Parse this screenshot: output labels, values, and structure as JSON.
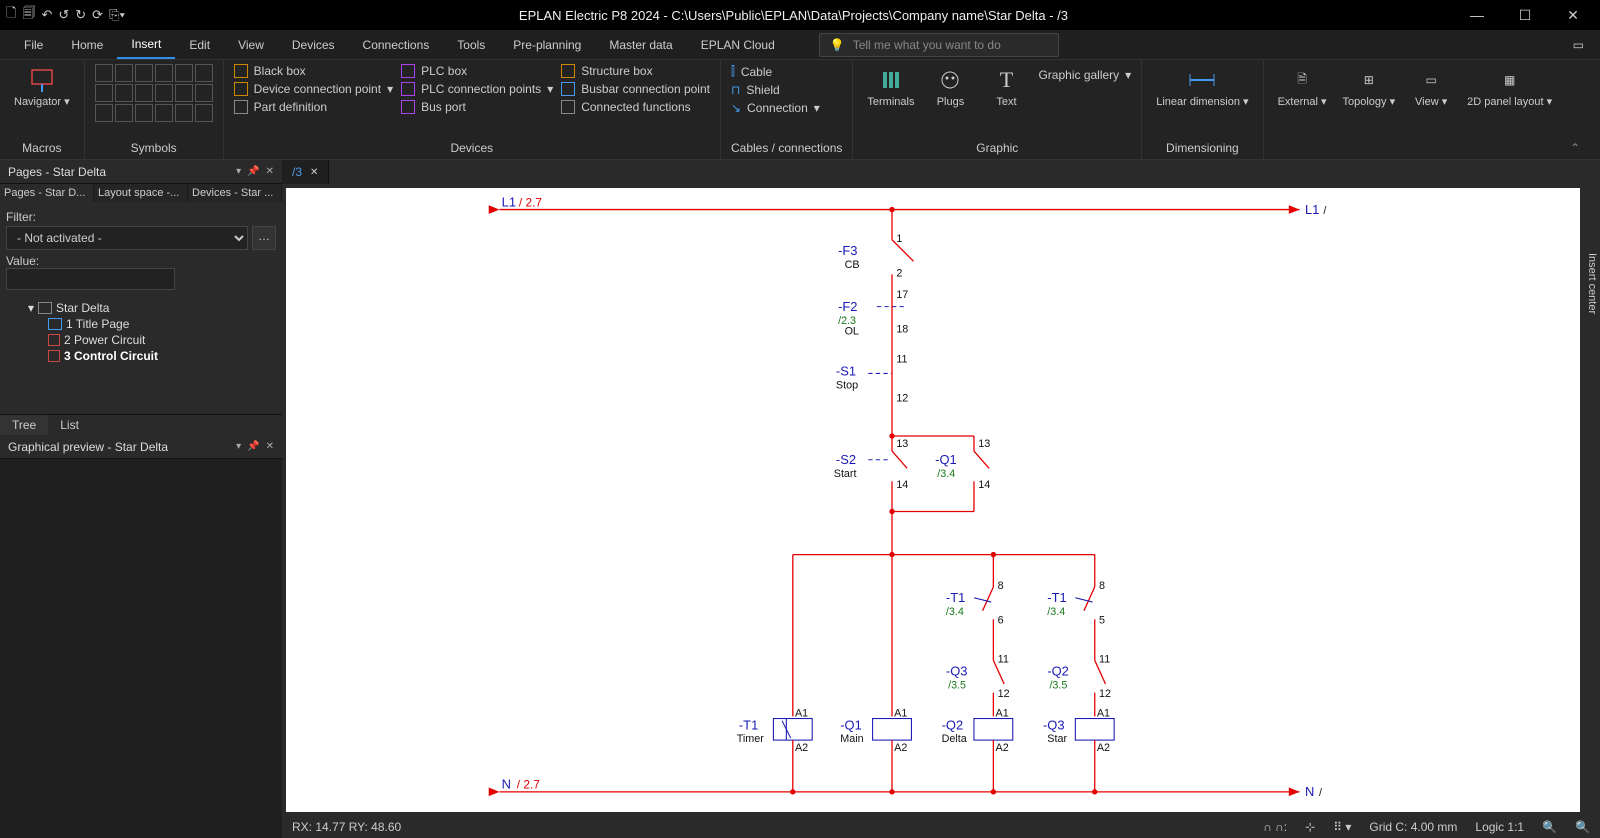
{
  "title": "EPLAN Electric P8 2024 - C:\\Users\\Public\\EPLAN\\Data\\Projects\\Company name\\Star Delta - /3",
  "menu": {
    "tabs": [
      "File",
      "Home",
      "Insert",
      "Edit",
      "View",
      "Devices",
      "Connections",
      "Tools",
      "Pre-planning",
      "Master data",
      "EPLAN Cloud"
    ],
    "active": 2,
    "search_placeholder": "Tell me what you want to do"
  },
  "ribbon": {
    "macros": {
      "navigator": "Navigator",
      "label": "Macros"
    },
    "symbols": {
      "label": "Symbols"
    },
    "devices": {
      "label": "Devices",
      "col1": [
        "Black box",
        "Device connection point",
        "Part definition"
      ],
      "col2": [
        "PLC box",
        "PLC connection points",
        "Bus port"
      ],
      "col3": [
        "Structure box",
        "Busbar connection point",
        "Connected functions"
      ]
    },
    "cables": {
      "label": "Cables / connections",
      "items": [
        "Cable",
        "Shield",
        "Connection"
      ]
    },
    "graphic": {
      "label": "Graphic",
      "terminals": "Terminals",
      "plugs": "Plugs",
      "text": "Text",
      "gallery": "Graphic gallery"
    },
    "dimensioning": {
      "label": "Dimensioning",
      "linear": "Linear dimension"
    },
    "external": "External",
    "topology": "Topology",
    "view": "View",
    "panel": "2D panel layout"
  },
  "pagesPanel": {
    "title": "Pages - Star Delta",
    "subtabs": [
      "Pages - Star D...",
      "Layout space -...",
      "Devices - Star ..."
    ],
    "filter_label": "Filter:",
    "filter_value": "- Not activated -",
    "value_label": "Value:",
    "root": "Star Delta",
    "pages": [
      "1 Title Page",
      "2 Power Circuit",
      "3 Control Circuit"
    ],
    "selected": 2,
    "view_tabs": [
      "Tree",
      "List"
    ]
  },
  "previewPanel": {
    "title": "Graphical preview - Star Delta"
  },
  "openTab": "/3",
  "rightDock": "Insert center",
  "status": {
    "coords": "RX: 14.77 RY: 48.60",
    "grid": "Grid C: 4.00 mm",
    "logic": "Logic 1:1"
  },
  "schematic": {
    "L1_left": "L1",
    "L1_left_xref": "/ 2.7",
    "L1_right": "L1",
    "L1_right_slash": "/",
    "N_left": "N",
    "N_left_xref": "/ 2.7",
    "N_right": "N",
    "N_right_slash": "/",
    "F3": {
      "dt": "-F3",
      "sub": "CB",
      "t1": "1",
      "t2": "2"
    },
    "F2": {
      "dt": "-F2",
      "sub": "OL",
      "xref": "/2.3",
      "t1": "17",
      "t2": "18"
    },
    "S1": {
      "dt": "-S1",
      "sub": "Stop",
      "t1": "11",
      "t2": "12"
    },
    "S2": {
      "dt": "-S2",
      "sub": "Start",
      "t1": "13",
      "t2": "14"
    },
    "Q1c": {
      "dt": "-Q1",
      "xref": "/3.4",
      "t1": "13",
      "t2": "14"
    },
    "T1a": {
      "dt": "-T1",
      "xref": "/3.4",
      "t1": "8",
      "t2": "6"
    },
    "T1b": {
      "dt": "-T1",
      "xref": "/3.4",
      "t1": "8",
      "t2": "5"
    },
    "Q3c": {
      "dt": "-Q3",
      "xref": "/3.5",
      "t1": "11",
      "t2": "12"
    },
    "Q2c": {
      "dt": "-Q2",
      "xref": "/3.5",
      "t1": "11",
      "t2": "12"
    },
    "coil_T1": {
      "dt": "-T1",
      "sub": "Timer",
      "a1": "A1",
      "a2": "A2"
    },
    "coil_Q1": {
      "dt": "-Q1",
      "sub": "Main",
      "a1": "A1",
      "a2": "A2"
    },
    "coil_Q2": {
      "dt": "-Q2",
      "sub": "Delta",
      "a1": "A1",
      "a2": "A2"
    },
    "coil_Q3": {
      "dt": "-Q3",
      "sub": "Star",
      "a1": "A1",
      "a2": "A2"
    }
  }
}
